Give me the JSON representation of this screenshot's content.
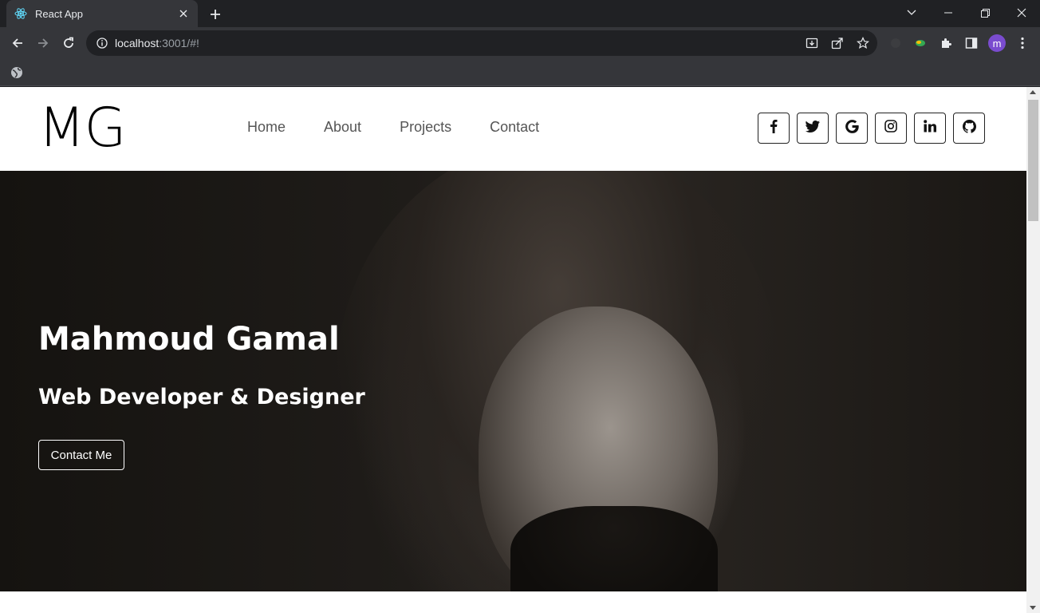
{
  "browser": {
    "tab_title": "React App",
    "url_host": "localhost",
    "url_rest": ":3001/#!",
    "profile_initial": "m"
  },
  "site": {
    "logo": "MG",
    "nav": [
      "Home",
      "About",
      "Projects",
      "Contact"
    ],
    "socials": [
      "facebook-icon",
      "twitter-icon",
      "google-icon",
      "instagram-icon",
      "linkedin-icon",
      "github-icon"
    ]
  },
  "hero": {
    "title": "Mahmoud Gamal",
    "subtitle": "Web Developer & Designer",
    "cta": "Contact Me"
  }
}
